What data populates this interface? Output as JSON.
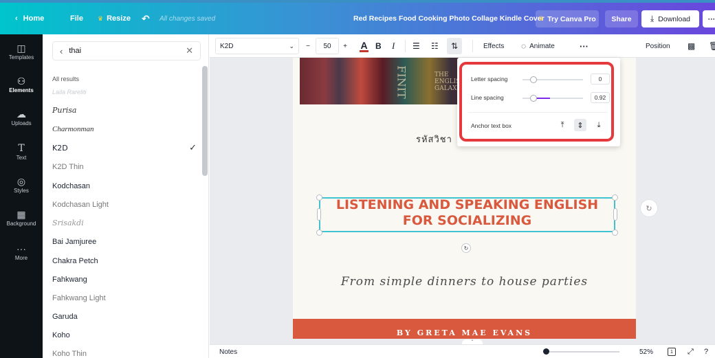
{
  "topbar": {
    "home": "Home",
    "file": "File",
    "resize": "Resize",
    "saved_status": "All changes saved",
    "doc_title": "Red Recipes Food Cooking Photo Collage Kindle Cover",
    "try_pro": "Try Canva Pro",
    "share": "Share",
    "download": "Download",
    "more": "···",
    "gradient_start": "#00c4cc",
    "gradient_end": "#6a47dd"
  },
  "rail": {
    "items": [
      {
        "label": "Templates",
        "icon": "templates-icon"
      },
      {
        "label": "Elements",
        "icon": "elements-icon"
      },
      {
        "label": "Uploads",
        "icon": "uploads-icon"
      },
      {
        "label": "Text",
        "icon": "text-icon"
      },
      {
        "label": "Styles",
        "icon": "styles-icon"
      },
      {
        "label": "Background",
        "icon": "background-icon"
      },
      {
        "label": "More",
        "icon": "more-icon"
      }
    ]
  },
  "font_panel": {
    "search_value": "thai",
    "results_header": "All results",
    "faded_item": "Laila Rareliti",
    "fonts": [
      "Purisa",
      "Charmonman",
      "K2D",
      "K2D Thin",
      "Kodchasan",
      "Kodchasan Light",
      "Srisakdi",
      "Bai Jamjuree",
      "Chakra Petch",
      "Fahkwang",
      "Fahkwang Light",
      "Garuda",
      "Koho",
      "Koho Thin"
    ],
    "selected_font": "K2D"
  },
  "toolbar": {
    "font_name": "K2D",
    "font_size": "50",
    "minus": "−",
    "plus": "+",
    "effects": "Effects",
    "animate": "Animate",
    "more": "···",
    "position": "Position",
    "text_color": "#c0392b"
  },
  "spacing_popover": {
    "letter_spacing_label": "Letter spacing",
    "letter_spacing_value": "0",
    "line_spacing_label": "Line spacing",
    "line_spacing_value": "0.92",
    "anchor_label": "Anchor text box",
    "highlight_color": "#e6393e",
    "slider_accent": "#7d2ae8"
  },
  "canvas": {
    "thai_text": "รหัสวิชา",
    "title_line1": "LISTENING AND SPEAKING ENGLISH",
    "title_line2": "FOR SOCIALIZING",
    "subtitle": "From simple dinners to house parties",
    "author": "BY GRETA MAE EVANS",
    "title_color": "#d9593e",
    "book_spines": [
      "THE ENGLISH GALAXY",
      "FINIT"
    ]
  },
  "bottombar": {
    "notes": "Notes",
    "zoom": "52%",
    "page_count": "1"
  }
}
